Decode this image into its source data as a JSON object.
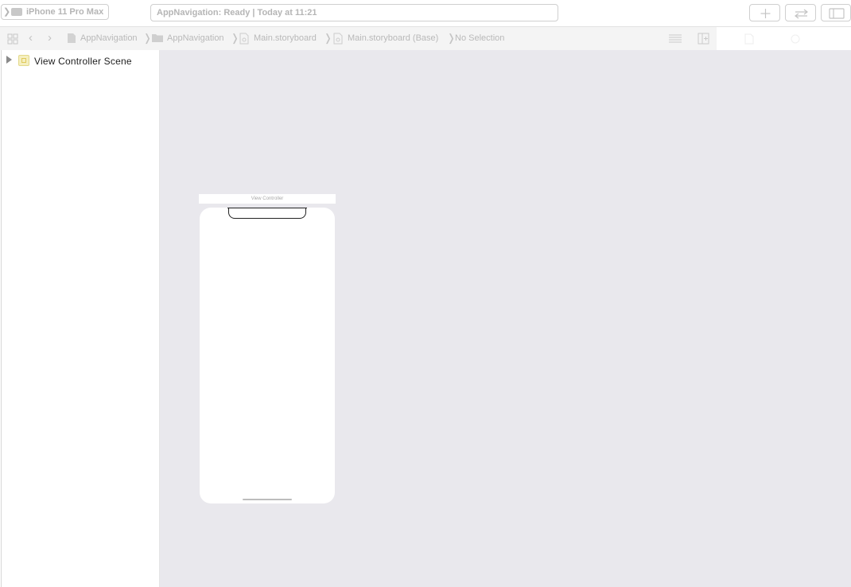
{
  "toolbar": {
    "scheme_device": "iPhone 11 Pro Max",
    "activity_status": "AppNavigation: Ready | Today at 11:21",
    "buttons": [
      "add-button",
      "swap-editor-button",
      "toggle-panel-button"
    ]
  },
  "jumpbar": {
    "crumbs": [
      {
        "label": "AppNavigation",
        "icon": "file-icon"
      },
      {
        "label": "AppNavigation",
        "icon": "folder-icon"
      },
      {
        "label": "Main.storyboard",
        "icon": "storyboard-icon"
      },
      {
        "label": "Main.storyboard (Base)",
        "icon": "storyboard-icon"
      },
      {
        "label": "No Selection",
        "icon": ""
      }
    ]
  },
  "navigator": {
    "scene_label": "View Controller Scene"
  },
  "canvas": {
    "scene_title": "View Controller",
    "background": "#e9e8ed"
  }
}
